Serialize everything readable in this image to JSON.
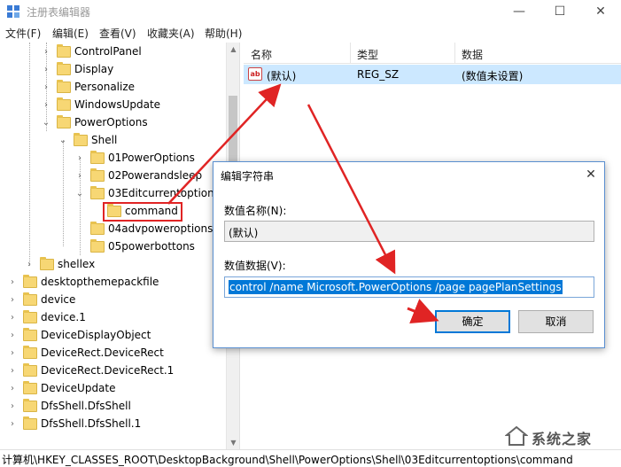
{
  "window": {
    "title": "注册表编辑器"
  },
  "menu": [
    "文件(F)",
    "编辑(E)",
    "查看(V)",
    "收藏夹(A)",
    "帮助(H)"
  ],
  "tree": [
    {
      "label": "ControlPanel"
    },
    {
      "label": "Display"
    },
    {
      "label": "Personalize"
    },
    {
      "label": "WindowsUpdate"
    },
    {
      "label": "PowerOptions"
    },
    {
      "label": "Shell"
    },
    {
      "label": "01PowerOptions"
    },
    {
      "label": "02Powerandsleep"
    },
    {
      "label": "03Editcurrentoptions"
    },
    {
      "label": "command"
    },
    {
      "label": "04advpoweroptions"
    },
    {
      "label": "05powerbottons"
    },
    {
      "label": "shellex"
    },
    {
      "label": "desktopthemepackfile"
    },
    {
      "label": "device"
    },
    {
      "label": "device.1"
    },
    {
      "label": "DeviceDisplayObject"
    },
    {
      "label": "DeviceRect.DeviceRect"
    },
    {
      "label": "DeviceRect.DeviceRect.1"
    },
    {
      "label": "DeviceUpdate"
    },
    {
      "label": "DfsShell.DfsShell"
    },
    {
      "label": "DfsShell.DfsShell.1"
    }
  ],
  "list": {
    "headers": [
      "名称",
      "类型",
      "数据"
    ],
    "rows": [
      {
        "name": "(默认)",
        "type": "REG_SZ",
        "data": "(数值未设置)"
      }
    ]
  },
  "dialog": {
    "title": "编辑字符串",
    "name_label": "数值名称(N):",
    "name_value": "(默认)",
    "data_label": "数值数据(V):",
    "data_value": "control /name Microsoft.PowerOptions /page pagePlanSettings",
    "ok_label": "确定",
    "cancel_label": "取消"
  },
  "status": "计算机\\HKEY_CLASSES_ROOT\\DesktopBackground\\Shell\\PowerOptions\\Shell\\03Editcurrentoptions\\command",
  "watermark": "系统之家",
  "colors": {
    "selection": "#cce8ff",
    "accent": "#0078d7",
    "annotation": "#e02424"
  }
}
